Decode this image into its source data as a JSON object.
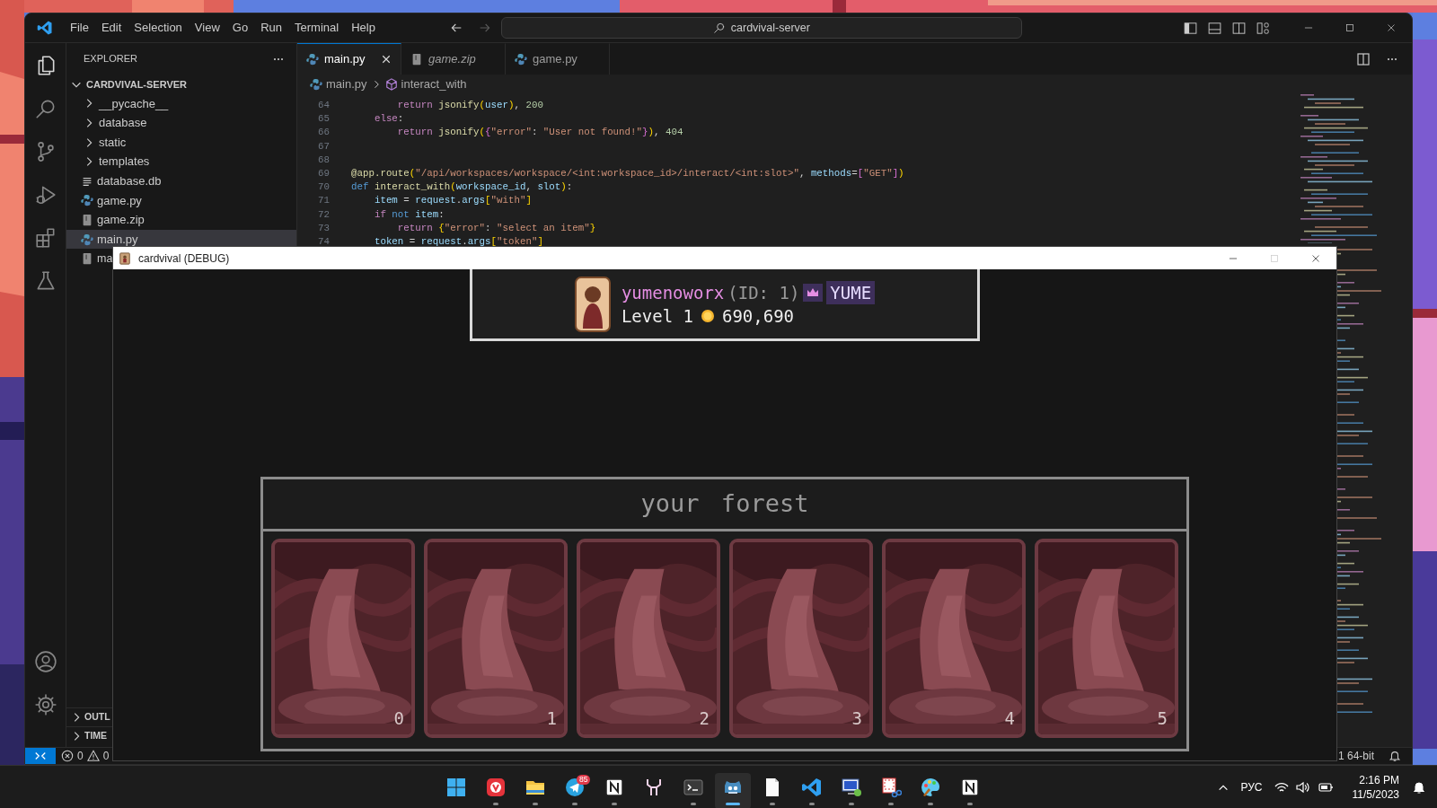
{
  "vscode": {
    "menu": [
      "File",
      "Edit",
      "Selection",
      "View",
      "Go",
      "Run",
      "Terminal",
      "Help"
    ],
    "nav": [
      {
        "kind": "back",
        "disabled": false
      },
      {
        "kind": "forward",
        "disabled": true
      }
    ],
    "command_center": "cardvival-server",
    "activity_bar": [
      {
        "kind": "explorer",
        "selected": true
      },
      {
        "kind": "search",
        "selected": false
      },
      {
        "kind": "source_control",
        "selected": false
      },
      {
        "kind": "run_debug",
        "selected": false
      },
      {
        "kind": "extensions",
        "selected": false
      },
      {
        "kind": "testing",
        "selected": false
      }
    ],
    "activity_bar_bottom": [
      {
        "kind": "account",
        "selected": false
      },
      {
        "kind": "settings",
        "selected": false
      }
    ],
    "explorer": {
      "title": "EXPLORER",
      "folder": {
        "name": "CARDVIVAL-SERVER",
        "expanded": true,
        "children": [
          {
            "name": "__pycache__",
            "kind": "folder",
            "expanded": false,
            "selected": false
          },
          {
            "name": "database",
            "kind": "folder",
            "expanded": false,
            "selected": false
          },
          {
            "name": "static",
            "kind": "folder",
            "expanded": false,
            "selected": false
          },
          {
            "name": "templates",
            "kind": "folder",
            "expanded": false,
            "selected": false
          },
          {
            "name": "database.db",
            "kind": "db",
            "selected": false
          },
          {
            "name": "game.py",
            "kind": "python",
            "selected": false
          },
          {
            "name": "game.zip",
            "kind": "file",
            "selected": false
          },
          {
            "name": "main.py",
            "kind": "python",
            "selected": true
          },
          {
            "name": "ma",
            "kind": "file",
            "selected": false
          }
        ]
      },
      "sections": [
        {
          "name": "OUTL",
          "expanded": false
        },
        {
          "name": "TIME",
          "expanded": false
        }
      ]
    },
    "tabs": [
      {
        "label": "main.py",
        "kind": "python",
        "selected": true,
        "preview": false
      },
      {
        "label": "game.zip",
        "kind": "file",
        "selected": false,
        "preview": true
      },
      {
        "label": "game.py",
        "kind": "python",
        "selected": false,
        "preview": false
      }
    ],
    "breadcrumb": [
      {
        "label": "main.py",
        "kind": "python"
      },
      {
        "label": "interact_with",
        "kind": "method"
      }
    ],
    "code": [
      {
        "number": "64",
        "tokens": [
          {
            "kind": "kw",
            "text": "        return "
          },
          {
            "kind": "fn",
            "text": "jsonify"
          },
          {
            "kind": "br1",
            "text": "("
          },
          {
            "kind": "var",
            "text": "user"
          },
          {
            "kind": "br1",
            "text": ")"
          },
          {
            "kind": "plain",
            "text": ", "
          },
          {
            "kind": "num",
            "text": "200"
          }
        ]
      },
      {
        "number": "65",
        "tokens": [
          {
            "kind": "kw",
            "text": "    else"
          },
          {
            "kind": "plain",
            "text": ":"
          }
        ]
      },
      {
        "number": "66",
        "tokens": [
          {
            "kind": "kw",
            "text": "        return "
          },
          {
            "kind": "fn",
            "text": "jsonify"
          },
          {
            "kind": "br1",
            "text": "("
          },
          {
            "kind": "br2",
            "text": "{"
          },
          {
            "kind": "str",
            "text": "\"error\""
          },
          {
            "kind": "plain",
            "text": ": "
          },
          {
            "kind": "str",
            "text": "\"User not found!\""
          },
          {
            "kind": "br2",
            "text": "}"
          },
          {
            "kind": "br1",
            "text": ")"
          },
          {
            "kind": "plain",
            "text": ", "
          },
          {
            "kind": "num",
            "text": "404"
          }
        ]
      },
      {
        "number": "67"
      },
      {
        "number": "68"
      },
      {
        "number": "69",
        "tokens": [
          {
            "kind": "fn",
            "text": "@app.route"
          },
          {
            "kind": "br1",
            "text": "("
          },
          {
            "kind": "str",
            "text": "\"/api/workspaces/workspace/<int:workspace_id>/interact/<int:slot>\""
          },
          {
            "kind": "plain",
            "text": ", "
          },
          {
            "kind": "var",
            "text": "methods"
          },
          {
            "kind": "plain",
            "text": "="
          },
          {
            "kind": "br2",
            "text": "["
          },
          {
            "kind": "str",
            "text": "\"GET\""
          },
          {
            "kind": "br2",
            "text": "]"
          },
          {
            "kind": "br1",
            "text": ")"
          }
        ]
      },
      {
        "number": "70",
        "tokens": [
          {
            "kind": "kw2",
            "text": "def "
          },
          {
            "kind": "fn",
            "text": "interact_with"
          },
          {
            "kind": "br1",
            "text": "("
          },
          {
            "kind": "var",
            "text": "workspace_id"
          },
          {
            "kind": "plain",
            "text": ", "
          },
          {
            "kind": "var",
            "text": "slot"
          },
          {
            "kind": "br1",
            "text": ")"
          },
          {
            "kind": "plain",
            "text": ":"
          }
        ]
      },
      {
        "number": "71",
        "tokens": [
          {
            "kind": "var",
            "text": "    item"
          },
          {
            "kind": "plain",
            "text": " = "
          },
          {
            "kind": "var",
            "text": "request"
          },
          {
            "kind": "plain",
            "text": "."
          },
          {
            "kind": "var",
            "text": "args"
          },
          {
            "kind": "br1",
            "text": "["
          },
          {
            "kind": "str",
            "text": "\"with\""
          },
          {
            "kind": "br1",
            "text": "]"
          }
        ]
      },
      {
        "number": "72",
        "tokens": [
          {
            "kind": "kw",
            "text": "    if "
          },
          {
            "kind": "kw2",
            "text": "not "
          },
          {
            "kind": "var",
            "text": "item"
          },
          {
            "kind": "plain",
            "text": ":"
          }
        ]
      },
      {
        "number": "73",
        "tokens": [
          {
            "kind": "kw",
            "text": "        return "
          },
          {
            "kind": "br1",
            "text": "{"
          },
          {
            "kind": "str",
            "text": "\"error\""
          },
          {
            "kind": "plain",
            "text": ": "
          },
          {
            "kind": "str",
            "text": "\"select an item\""
          },
          {
            "kind": "br1",
            "text": "}"
          }
        ]
      },
      {
        "number": "74",
        "tokens": [
          {
            "kind": "var",
            "text": "    token"
          },
          {
            "kind": "plain",
            "text": " = "
          },
          {
            "kind": "var",
            "text": "request"
          },
          {
            "kind": "plain",
            "text": "."
          },
          {
            "kind": "var",
            "text": "args"
          },
          {
            "kind": "br1",
            "text": "["
          },
          {
            "kind": "str",
            "text": "\"token\""
          },
          {
            "kind": "br1",
            "text": "]"
          }
        ]
      }
    ],
    "status_bar": {
      "errors": "0",
      "warnings": "0",
      "interpreter": "1 64-bit"
    }
  },
  "game_window": {
    "title": "cardvival (DEBUG)",
    "can_maximize": false,
    "player": {
      "name": "yumenoworx",
      "id": "(ID: 1)",
      "tag": "YUME",
      "level": "Level 1",
      "coins": "690,690"
    },
    "forest": {
      "title": "your forest",
      "cards": [
        {
          "slot": "0"
        },
        {
          "slot": "1"
        },
        {
          "slot": "2"
        },
        {
          "slot": "3"
        },
        {
          "slot": "4"
        },
        {
          "slot": "5"
        }
      ]
    }
  },
  "taskbar": {
    "apps": [
      {
        "kind": "start",
        "running": false,
        "active": false
      },
      {
        "kind": "browser",
        "running": true,
        "active": false
      },
      {
        "kind": "folder",
        "running": true,
        "active": false
      },
      {
        "kind": "messenger",
        "running": true,
        "active": false,
        "badge": "85"
      },
      {
        "kind": "notes",
        "running": true,
        "active": false
      },
      {
        "kind": "stag",
        "running": false,
        "active": false
      },
      {
        "kind": "terminal",
        "running": true,
        "active": false
      },
      {
        "kind": "robot",
        "running": true,
        "active": true
      },
      {
        "kind": "document",
        "running": true,
        "active": false
      },
      {
        "kind": "code",
        "running": true,
        "active": false
      },
      {
        "kind": "monitor",
        "running": true,
        "active": false
      },
      {
        "kind": "scissors",
        "running": true,
        "active": false
      },
      {
        "kind": "palette",
        "running": true,
        "active": false
      },
      {
        "kind": "notes",
        "running": true,
        "active": false
      }
    ],
    "language": "РУС",
    "time": "2:16 PM",
    "date": "11/5/2023"
  }
}
